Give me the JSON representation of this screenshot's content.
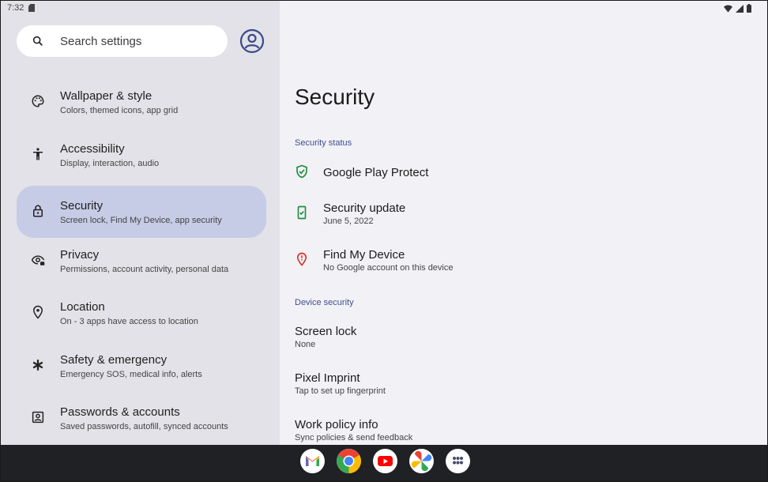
{
  "status_bar": {
    "time": "7:32"
  },
  "search": {
    "placeholder": "Search settings"
  },
  "sidebar": {
    "items": [
      {
        "title": "Wallpaper & style",
        "subtitle": "Colors, themed icons, app grid",
        "icon": "palette-icon"
      },
      {
        "title": "Accessibility",
        "subtitle": "Display, interaction, audio",
        "icon": "accessibility-icon"
      },
      {
        "title": "Security",
        "subtitle": "Screen lock, Find My Device, app security",
        "icon": "lock-icon",
        "selected": true
      },
      {
        "title": "Privacy",
        "subtitle": "Permissions, account activity, personal data",
        "icon": "eye-lock-icon"
      },
      {
        "title": "Location",
        "subtitle": "On - 3 apps have access to location",
        "icon": "location-pin-icon"
      },
      {
        "title": "Safety & emergency",
        "subtitle": "Emergency SOS, medical info, alerts",
        "icon": "asterisk-icon"
      },
      {
        "title": "Passwords & accounts",
        "subtitle": "Saved passwords, autofill, synced accounts",
        "icon": "account-box-icon"
      }
    ]
  },
  "main": {
    "title": "Security",
    "status_header": "Security status",
    "status_items": [
      {
        "title": "Google Play Protect",
        "subtitle": "",
        "icon": "shield-check-icon",
        "color": "#1e8e3e"
      },
      {
        "title": "Security update",
        "subtitle": "June 5, 2022",
        "icon": "phone-check-icon",
        "color": "#1e8e3e"
      },
      {
        "title": "Find My Device",
        "subtitle": "No Google account on this device",
        "icon": "location-alert-icon",
        "color": "#d93025"
      }
    ],
    "device_header": "Device security",
    "device_items": [
      {
        "title": "Screen lock",
        "subtitle": "None"
      },
      {
        "title": "Pixel Imprint",
        "subtitle": "Tap to set up fingerprint"
      },
      {
        "title": "Work policy info",
        "subtitle": "Sync policies & send feedback"
      }
    ]
  },
  "taskbar": {
    "apps": [
      "gmail-icon",
      "chrome-icon",
      "youtube-icon",
      "photos-icon",
      "app-drawer-icon"
    ]
  },
  "colors": {
    "left_pane": "#e3e2e8",
    "right_pane": "#f2f1f6",
    "selected": "#c6cbe6",
    "accent_header": "#3f4f8f",
    "taskbar": "#202124"
  }
}
